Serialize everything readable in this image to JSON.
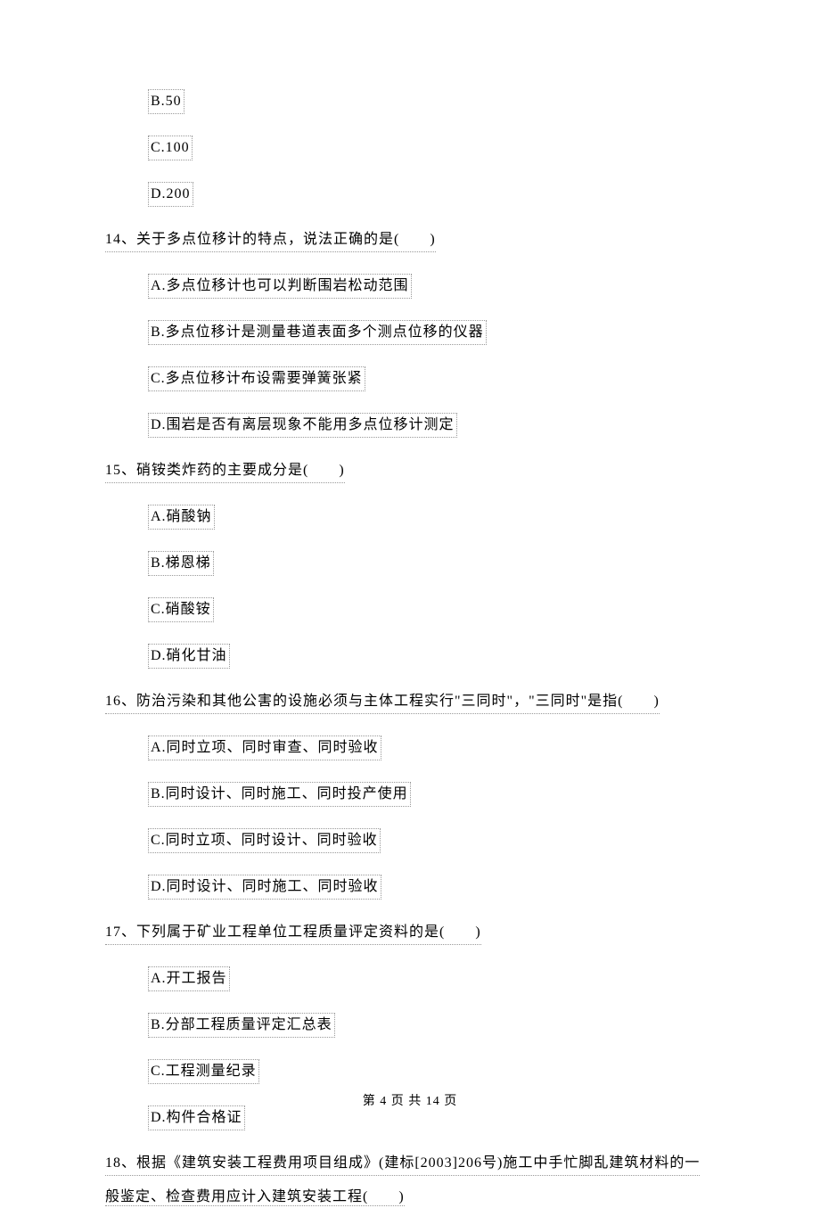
{
  "prev_options": {
    "b": "B.50",
    "c": "C.100",
    "d": "D.200"
  },
  "q14": {
    "text": "14、关于多点位移计的特点，说法正确的是(　　)",
    "a": "A.多点位移计也可以判断围岩松动范围",
    "b": "B.多点位移计是测量巷道表面多个测点位移的仪器",
    "c": "C.多点位移计布设需要弹簧张紧",
    "d": "D.围岩是否有离层现象不能用多点位移计测定"
  },
  "q15": {
    "text": "15、硝铵类炸药的主要成分是(　　)",
    "a": "A.硝酸钠",
    "b": "B.梯恩梯",
    "c": "C.硝酸铵",
    "d": "D.硝化甘油"
  },
  "q16": {
    "text": "16、防治污染和其他公害的设施必须与主体工程实行\"三同时\"，\"三同时\"是指(　　)",
    "a": "A.同时立项、同时审查、同时验收",
    "b": "B.同时设计、同时施工、同时投产使用",
    "c": "C.同时立项、同时设计、同时验收",
    "d": "D.同时设计、同时施工、同时验收"
  },
  "q17": {
    "text": "17、下列属于矿业工程单位工程质量评定资料的是(　　)",
    "a": "A.开工报告",
    "b": "B.分部工程质量评定汇总表",
    "c": "C.工程测量纪录",
    "d": "D.构件合格证"
  },
  "q18": {
    "line1": "18、根据《建筑安装工程费用项目组成》(建标[2003]206号)施工中手忙脚乱建筑材料的一",
    "line2": "般鉴定、检查费用应计入建筑安装工程(　　)"
  },
  "footer": "第 4 页 共 14 页"
}
